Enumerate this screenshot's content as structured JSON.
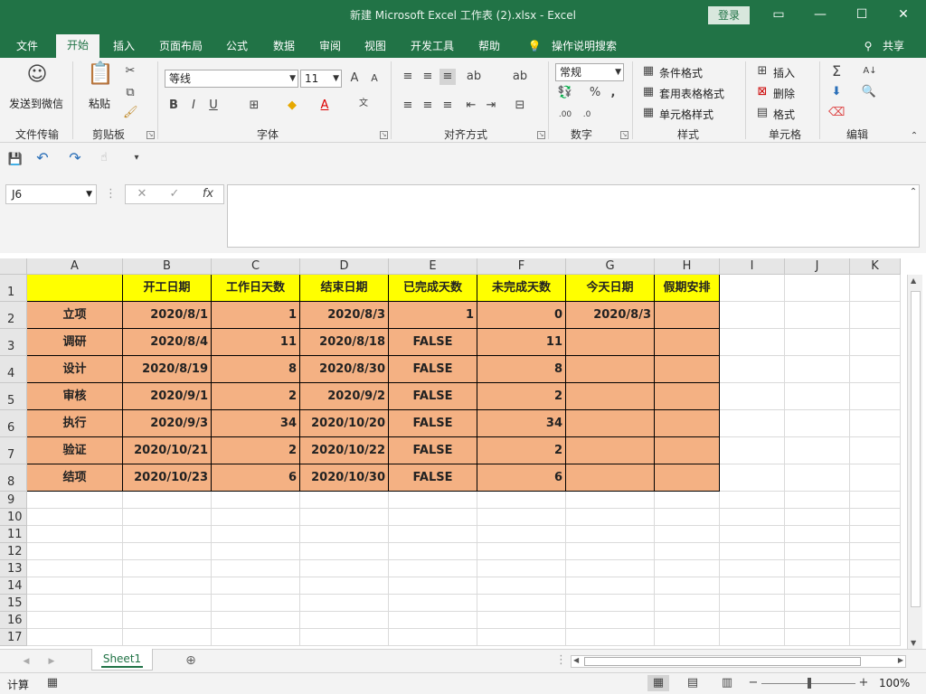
{
  "window": {
    "title": "新建 Microsoft Excel 工作表 (2).xlsx  -  Excel",
    "login": "登录",
    "share": "共享"
  },
  "tabs": [
    "文件",
    "开始",
    "插入",
    "页面布局",
    "公式",
    "数据",
    "审阅",
    "视图",
    "开发工具",
    "帮助"
  ],
  "tell_me": "操作说明搜索",
  "ribbon": {
    "wechat": "发送到微信",
    "paste": "粘贴",
    "font_name": "等线",
    "font_size": "11",
    "number_format": "常规",
    "cond_format": "条件格式",
    "table_format": "套用表格格式",
    "cell_style": "单元格样式",
    "insert": "插入",
    "delete": "删除",
    "format": "格式",
    "groups": {
      "file_transfer": "文件传输",
      "clipboard": "剪贴板",
      "font": "字体",
      "align": "对齐方式",
      "number": "数字",
      "style": "样式",
      "cells": "单元格",
      "edit": "编辑"
    }
  },
  "formula_bar": {
    "name_box": "J6",
    "fx": "fx",
    "formula": ""
  },
  "sheet": {
    "columns": [
      "A",
      "B",
      "C",
      "D",
      "E",
      "F",
      "G",
      "H",
      "I",
      "J",
      "K"
    ],
    "row_numbers": [
      "1",
      "2",
      "3",
      "4",
      "5",
      "6",
      "7",
      "8",
      "9",
      "10",
      "11",
      "12",
      "13",
      "14",
      "15",
      "16",
      "17"
    ],
    "headers": [
      "",
      "开工日期",
      "工作日天数",
      "结束日期",
      "已完成天数",
      "未完成天数",
      "今天日期",
      "假期安排"
    ],
    "rows": [
      [
        "立项",
        "2020/8/1",
        "1",
        "2020/8/3",
        "1",
        "0",
        "2020/8/3",
        ""
      ],
      [
        "调研",
        "2020/8/4",
        "11",
        "2020/8/18",
        "FALSE",
        "11",
        "",
        ""
      ],
      [
        "设计",
        "2020/8/19",
        "8",
        "2020/8/30",
        "FALSE",
        "8",
        "",
        ""
      ],
      [
        "审核",
        "2020/9/1",
        "2",
        "2020/9/2",
        "FALSE",
        "2",
        "",
        ""
      ],
      [
        "执行",
        "2020/9/3",
        "34",
        "2020/10/20",
        "FALSE",
        "34",
        "",
        ""
      ],
      [
        "验证",
        "2020/10/21",
        "2",
        "2020/10/22",
        "FALSE",
        "2",
        "",
        ""
      ],
      [
        "结项",
        "2020/10/23",
        "6",
        "2020/10/30",
        "FALSE",
        "6",
        "",
        ""
      ]
    ],
    "tab_name": "Sheet1"
  },
  "status": {
    "mode": "计算",
    "zoom": "100%"
  }
}
